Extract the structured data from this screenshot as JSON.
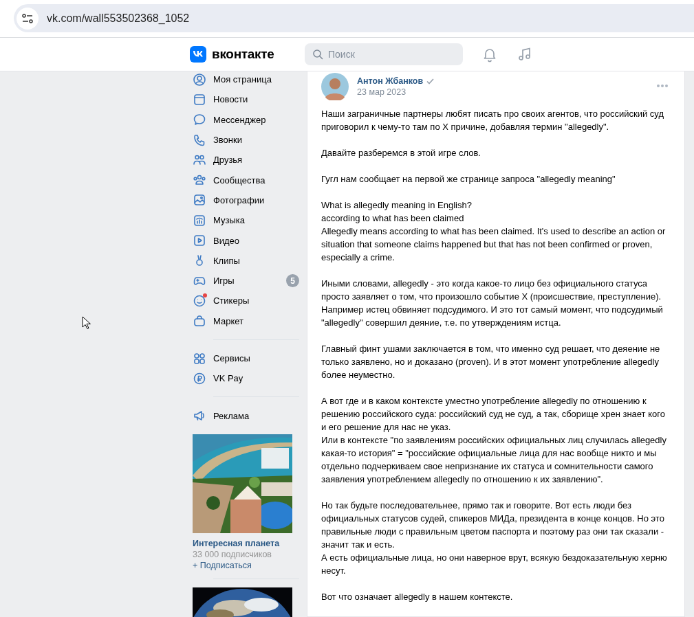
{
  "browser": {
    "url": "vk.com/wall553502368_1052"
  },
  "header": {
    "logo": "вконтакте",
    "search": {
      "placeholder": "Поиск"
    }
  },
  "sidebar": {
    "groups": [
      [
        {
          "label": "Моя страница"
        },
        {
          "label": "Новости"
        },
        {
          "label": "Мессенджер"
        },
        {
          "label": "Звонки"
        },
        {
          "label": "Друзья"
        },
        {
          "label": "Сообщества"
        },
        {
          "label": "Фотографии"
        },
        {
          "label": "Музыка"
        },
        {
          "label": "Видео"
        },
        {
          "label": "Клипы"
        },
        {
          "label": "Игры",
          "badge": "5"
        },
        {
          "label": "Стикеры",
          "notification": true
        },
        {
          "label": "Маркет"
        }
      ],
      [
        {
          "label": "Сервисы"
        },
        {
          "label": "VK Pay"
        }
      ],
      [
        {
          "label": "Реклама"
        }
      ]
    ],
    "promo": {
      "title": "Интересная планета",
      "subtitle": "33 000 подписчиков",
      "action": "+ Подписаться"
    }
  },
  "post": {
    "author": "Антон Жбанков",
    "verified": true,
    "date": "23 мар 2023",
    "paragraphs": [
      [
        "Наши заграничные партнеры любят писать про своих агентов, что российский суд приговорил к чему-то там по X причине, добавляя термин \"allegedly\"."
      ],
      [
        "Давайте разберемся в этой игре слов."
      ],
      [
        "Гугл нам сообщает на первой же странице запроса \"allegedly meaning\""
      ],
      [
        "What is allegedly meaning in English?",
        "according to what has been claimed",
        "Allegedly means according to what has been claimed. It's used to describe an action or situation that someone claims happened but that has not been confirmed or proven, especially a crime."
      ],
      [
        "Иными словами, allegedly - это когда какое-то лицо без официального статуса просто заявляет о том, что произошло событие X (происшествие, преступление). Например истец обвиняет подсудимого. И это тот самый момент, что подсудимый \"allegedly\" совершил деяние, т.е. по утверждениям истца."
      ],
      [
        "Главный финт ушами заключается в том, что именно суд решает, что деяение не только заявлено, но и доказано (proven). И в этот момент употребление allegedly более неуместно."
      ],
      [
        "А вот где и в каком контексте уместно употребление allegedly по отношению к решению российского суда: российский суд не суд, а так, сборище хрен знает кого и его решение для нас не указ.",
        "Или в контексте \"по заявлениям российских официальных лиц случилась allegedly какая-то история\" = \"российские официальные лица для нас вообще никто и мы отдельно подчеркиваем свое непризнание их статуса и сомнительности самого заявления употреблением allegedly по отношению к их заявлению\"."
      ],
      [
        "Но так будьте последовательнее, прямо так и говорите. Вот есть люди без официальных статусов судей, спикеров МИДа, президента в конце концов. Но это правильные люди с правильным цветом паспорта и поэтому раз они так сказали - значит так и есть.",
        "А есть официальные лица, но они наверное врут, всякую бездоказательную херню несут."
      ],
      [
        "Вот что означает allegedly в нашем контексте."
      ]
    ]
  }
}
